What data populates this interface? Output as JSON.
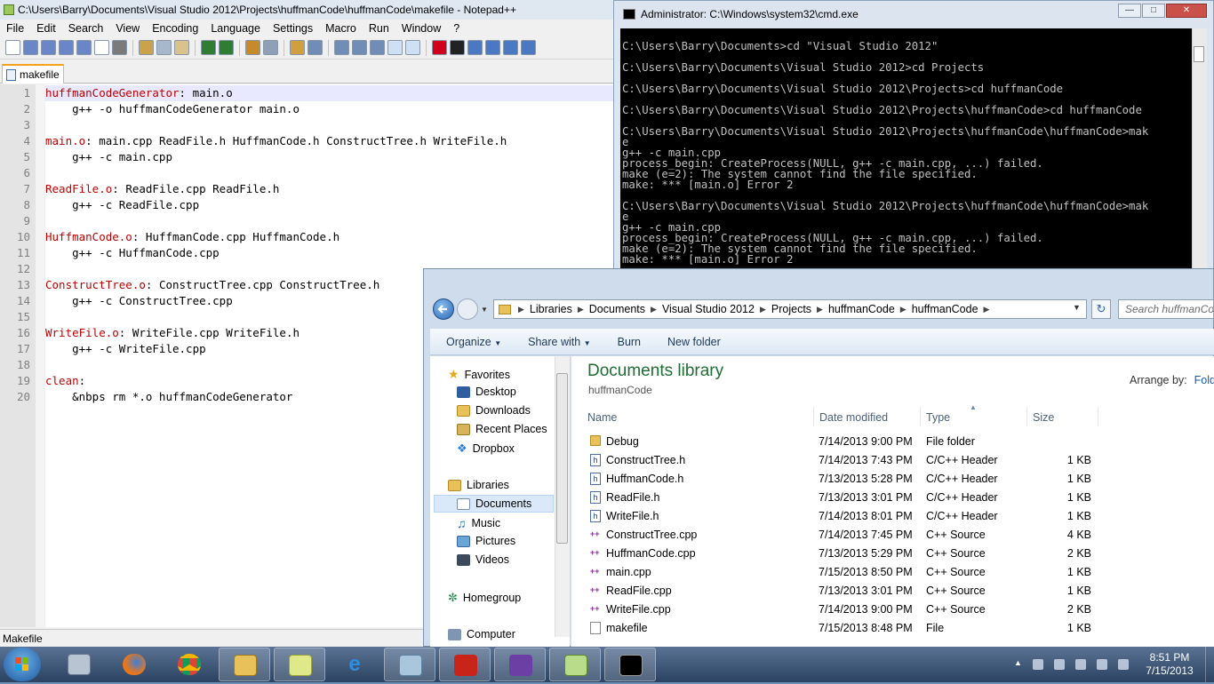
{
  "notepad": {
    "title": "C:\\Users\\Barry\\Documents\\Visual Studio 2012\\Projects\\huffmanCode\\huffmanCode\\makefile - Notepad++",
    "menu": [
      "File",
      "Edit",
      "Search",
      "View",
      "Encoding",
      "Language",
      "Settings",
      "Macro",
      "Run",
      "Window",
      "?"
    ],
    "tab": "makefile",
    "status": "Makefile",
    "lines": [
      {
        "n": "1",
        "t": "huffmanCodeGenerator",
        "r": ": main.o"
      },
      {
        "n": "2",
        "t": "",
        "r": "    g++ -o huffmanCodeGenerator main.o"
      },
      {
        "n": "3",
        "t": "",
        "r": ""
      },
      {
        "n": "4",
        "t": "main.o",
        "r": ": main.cpp ReadFile.h HuffmanCode.h ConstructTree.h WriteFile.h"
      },
      {
        "n": "5",
        "t": "",
        "r": "    g++ -c main.cpp"
      },
      {
        "n": "6",
        "t": "",
        "r": ""
      },
      {
        "n": "7",
        "t": "ReadFile.o",
        "r": ": ReadFile.cpp ReadFile.h"
      },
      {
        "n": "8",
        "t": "",
        "r": "    g++ -c ReadFile.cpp"
      },
      {
        "n": "9",
        "t": "",
        "r": ""
      },
      {
        "n": "10",
        "t": "HuffmanCode.o",
        "r": ": HuffmanCode.cpp HuffmanCode.h"
      },
      {
        "n": "11",
        "t": "",
        "r": "    g++ -c HuffmanCode.cpp"
      },
      {
        "n": "12",
        "t": "",
        "r": ""
      },
      {
        "n": "13",
        "t": "ConstructTree.o",
        "r": ": ConstructTree.cpp ConstructTree.h"
      },
      {
        "n": "14",
        "t": "",
        "r": "    g++ -c ConstructTree.cpp"
      },
      {
        "n": "15",
        "t": "",
        "r": ""
      },
      {
        "n": "16",
        "t": "WriteFile.o",
        "r": ": WriteFile.cpp WriteFile.h"
      },
      {
        "n": "17",
        "t": "",
        "r": "    g++ -c WriteFile.cpp"
      },
      {
        "n": "18",
        "t": "",
        "r": ""
      },
      {
        "n": "19",
        "t": "clean",
        "r": ":"
      },
      {
        "n": "20",
        "t": "",
        "r": "    &nbps rm *.o huffmanCodeGenerator"
      }
    ]
  },
  "cmd": {
    "title": "Administrator: C:\\Windows\\system32\\cmd.exe",
    "output": "\nC:\\Users\\Barry\\Documents>cd \"Visual Studio 2012\"\n\nC:\\Users\\Barry\\Documents\\Visual Studio 2012>cd Projects\n\nC:\\Users\\Barry\\Documents\\Visual Studio 2012\\Projects>cd huffmanCode\n\nC:\\Users\\Barry\\Documents\\Visual Studio 2012\\Projects\\huffmanCode>cd huffmanCode\n\nC:\\Users\\Barry\\Documents\\Visual Studio 2012\\Projects\\huffmanCode\\huffmanCode>mak\ne\ng++ -c main.cpp\nprocess_begin: CreateProcess(NULL, g++ -c main.cpp, ...) failed.\nmake (e=2): The system cannot find the file specified.\nmake: *** [main.o] Error 2\n\nC:\\Users\\Barry\\Documents\\Visual Studio 2012\\Projects\\huffmanCode\\huffmanCode>mak\ne\ng++ -c main.cpp\nprocess_begin: CreateProcess(NULL, g++ -c main.cpp, ...) failed.\nmake (e=2): The system cannot find the file specified.\nmake: *** [main.o] Error 2"
  },
  "explorer": {
    "breadcrumb": [
      "Libraries",
      "Documents",
      "Visual Studio 2012",
      "Projects",
      "huffmanCode",
      "huffmanCode"
    ],
    "search_placeholder": "Search huffmanCode",
    "toolbar": {
      "organize": "Organize",
      "share": "Share with",
      "burn": "Burn",
      "new_folder": "New folder"
    },
    "nav": {
      "favorites": "Favorites",
      "desktop": "Desktop",
      "downloads": "Downloads",
      "recent": "Recent Places",
      "dropbox": "Dropbox",
      "libraries": "Libraries",
      "documents": "Documents",
      "music": "Music",
      "pictures": "Pictures",
      "videos": "Videos",
      "homegroup": "Homegroup",
      "computer": "Computer"
    },
    "library_title": "Documents library",
    "library_sub": "huffmanCode",
    "arrange_label": "Arrange by:",
    "arrange_value": "Folder",
    "columns": {
      "name": "Name",
      "date": "Date modified",
      "type": "Type",
      "size": "Size"
    },
    "files": [
      {
        "name": "Debug",
        "date": "7/14/2013 9:00 PM",
        "type": "File folder",
        "size": "",
        "kind": "folder"
      },
      {
        "name": "ConstructTree.h",
        "date": "7/14/2013 7:43 PM",
        "type": "C/C++ Header",
        "size": "1 KB",
        "kind": "hdr"
      },
      {
        "name": "HuffmanCode.h",
        "date": "7/13/2013 5:28 PM",
        "type": "C/C++ Header",
        "size": "1 KB",
        "kind": "hdr"
      },
      {
        "name": "ReadFile.h",
        "date": "7/13/2013 3:01 PM",
        "type": "C/C++ Header",
        "size": "1 KB",
        "kind": "hdr"
      },
      {
        "name": "WriteFile.h",
        "date": "7/14/2013 8:01 PM",
        "type": "C/C++ Header",
        "size": "1 KB",
        "kind": "hdr"
      },
      {
        "name": "ConstructTree.cpp",
        "date": "7/14/2013 7:45 PM",
        "type": "C++ Source",
        "size": "4 KB",
        "kind": "cpp"
      },
      {
        "name": "HuffmanCode.cpp",
        "date": "7/13/2013 5:29 PM",
        "type": "C++ Source",
        "size": "2 KB",
        "kind": "cpp"
      },
      {
        "name": "main.cpp",
        "date": "7/15/2013 8:50 PM",
        "type": "C++ Source",
        "size": "1 KB",
        "kind": "cpp"
      },
      {
        "name": "ReadFile.cpp",
        "date": "7/13/2013 3:01 PM",
        "type": "C++ Source",
        "size": "1 KB",
        "kind": "cpp"
      },
      {
        "name": "WriteFile.cpp",
        "date": "7/14/2013 9:00 PM",
        "type": "C++ Source",
        "size": "2 KB",
        "kind": "cpp"
      },
      {
        "name": "makefile",
        "date": "7/15/2013 8:48 PM",
        "type": "File",
        "size": "1 KB",
        "kind": "plain"
      }
    ]
  },
  "taskbar": {
    "time": "8:51 PM",
    "date": "7/15/2013"
  }
}
